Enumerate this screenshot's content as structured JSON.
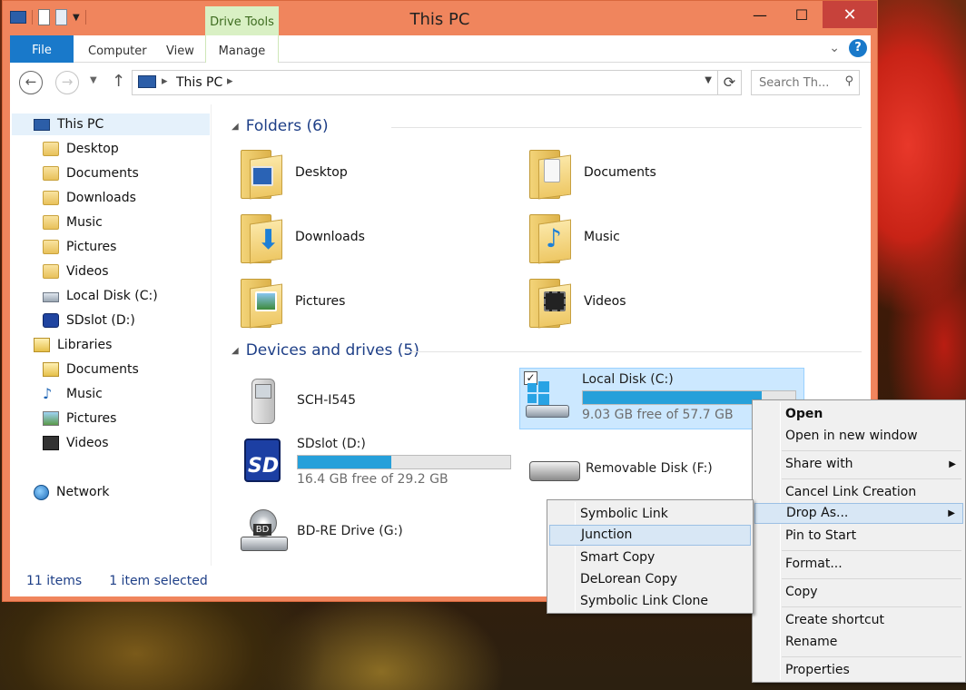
{
  "window": {
    "title": "This PC",
    "controls": {
      "minimize": "—",
      "maximize": "☐",
      "close": "✕"
    }
  },
  "ribbon": {
    "contextual_tab": "Drive Tools",
    "tabs": [
      "File",
      "Computer",
      "View",
      "Manage"
    ],
    "help": "?"
  },
  "address": {
    "crumb": "This PC",
    "search_placeholder": "Search Th..."
  },
  "nav": {
    "this_pc": "This PC",
    "pc_items": [
      "Desktop",
      "Documents",
      "Downloads",
      "Music",
      "Pictures",
      "Videos",
      "Local Disk (C:)",
      "SDslot (D:)"
    ],
    "libraries": "Libraries",
    "lib_items": [
      "Documents",
      "Music",
      "Pictures",
      "Videos"
    ],
    "network": "Network"
  },
  "content": {
    "folders_header": "Folders (6)",
    "folders": [
      "Desktop",
      "Documents",
      "Downloads",
      "Music",
      "Pictures",
      "Videos"
    ],
    "devices_header": "Devices and drives (5)",
    "devices": {
      "phone": "SCH-I545",
      "c_name": "Local Disk (C:)",
      "c_free": "9.03 GB free of 57.7 GB",
      "c_used_fraction": 0.84,
      "d_name": "SDslot (D:)",
      "d_free": "16.4 GB free of 29.2 GB",
      "d_used_fraction": 0.44,
      "f_name": "Removable Disk (F:)",
      "g_name": "BD-RE Drive (G:)",
      "g_badge": "BD"
    }
  },
  "status": {
    "count": "11 items",
    "selected": "1 item selected"
  },
  "context_menu": {
    "open": "Open",
    "open_new": "Open in new window",
    "share_with": "Share with",
    "cancel_link": "Cancel Link Creation",
    "drop_as": "Drop As...",
    "pin": "Pin to Start",
    "format": "Format...",
    "copy": "Copy",
    "create_shortcut": "Create shortcut",
    "rename": "Rename",
    "properties": "Properties"
  },
  "submenu": [
    "Symbolic Link",
    "Junction",
    "Smart Copy",
    "DeLorean Copy",
    "Symbolic Link Clone"
  ],
  "colors": {
    "accent": "#1979ca",
    "window_frame": "#f0855d",
    "progress": "#26a0da",
    "selection": "#cce8ff"
  }
}
